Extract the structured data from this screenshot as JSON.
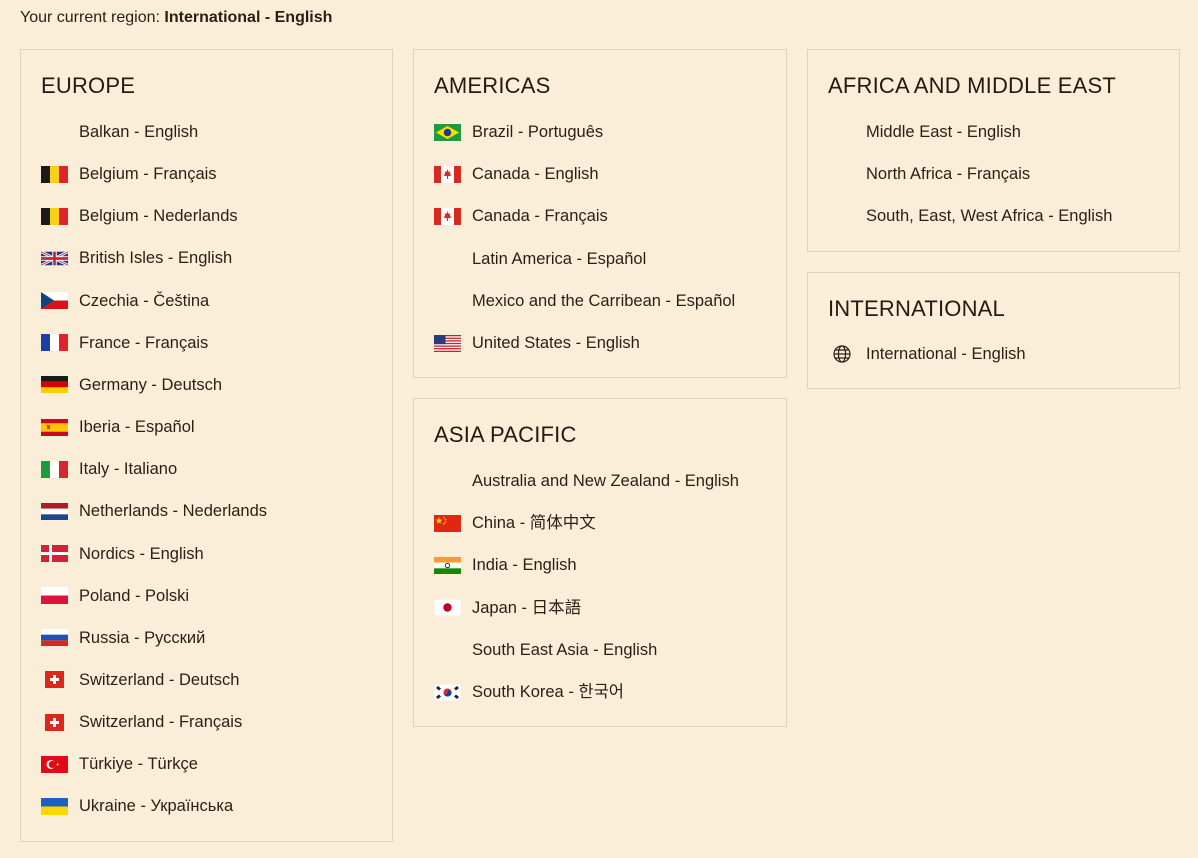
{
  "header": {
    "prefix": "Your current region:",
    "current": "International - English"
  },
  "europe": {
    "title": "EUROPE",
    "items": [
      {
        "label": "Balkan - English",
        "flag": "none"
      },
      {
        "label": "Belgium - Français",
        "flag": "belgium"
      },
      {
        "label": "Belgium - Nederlands",
        "flag": "belgium"
      },
      {
        "label": "British Isles - English",
        "flag": "uk"
      },
      {
        "label": "Czechia - Čeština",
        "flag": "czechia"
      },
      {
        "label": "France - Français",
        "flag": "france"
      },
      {
        "label": "Germany - Deutsch",
        "flag": "germany"
      },
      {
        "label": "Iberia - Español",
        "flag": "spain"
      },
      {
        "label": "Italy - Italiano",
        "flag": "italy"
      },
      {
        "label": "Netherlands - Nederlands",
        "flag": "netherlands"
      },
      {
        "label": "Nordics - English",
        "flag": "denmark"
      },
      {
        "label": "Poland - Polski",
        "flag": "poland"
      },
      {
        "label": "Russia - Русский",
        "flag": "russia"
      },
      {
        "label": "Switzerland - Deutsch",
        "flag": "switzerland"
      },
      {
        "label": "Switzerland - Français",
        "flag": "switzerland"
      },
      {
        "label": "Türkiye - Türkçe",
        "flag": "turkey"
      },
      {
        "label": "Ukraine - Українська",
        "flag": "ukraine"
      }
    ]
  },
  "americas": {
    "title": "AMERICAS",
    "items": [
      {
        "label": "Brazil - Português",
        "flag": "brazil"
      },
      {
        "label": "Canada - English",
        "flag": "canada"
      },
      {
        "label": "Canada - Français",
        "flag": "canada"
      },
      {
        "label": "Latin America - Español",
        "flag": "none"
      },
      {
        "label": "Mexico and the Carribean - Español",
        "flag": "none"
      },
      {
        "label": "United States - English",
        "flag": "usa"
      }
    ]
  },
  "asia": {
    "title": "ASIA PACIFIC",
    "items": [
      {
        "label": "Australia and New Zealand - English",
        "flag": "none"
      },
      {
        "label": "China - 简体中文",
        "flag": "china"
      },
      {
        "label": "India - English",
        "flag": "india"
      },
      {
        "label": "Japan - 日本語",
        "flag": "japan"
      },
      {
        "label": "South East Asia - English",
        "flag": "none"
      },
      {
        "label": "South Korea - 한국어",
        "flag": "korea"
      }
    ]
  },
  "africa": {
    "title": "AFRICA AND MIDDLE EAST",
    "items": [
      {
        "label": "Middle East - English",
        "flag": "none"
      },
      {
        "label": "North Africa - Français",
        "flag": "none"
      },
      {
        "label": "South, East, West Africa - English",
        "flag": "none"
      }
    ]
  },
  "international": {
    "title": "INTERNATIONAL",
    "items": [
      {
        "label": "International - English",
        "flag": "globe"
      }
    ]
  },
  "colors": {
    "background": "#faeed9",
    "border": "#e3d2b5",
    "text": "#2a1f14"
  }
}
